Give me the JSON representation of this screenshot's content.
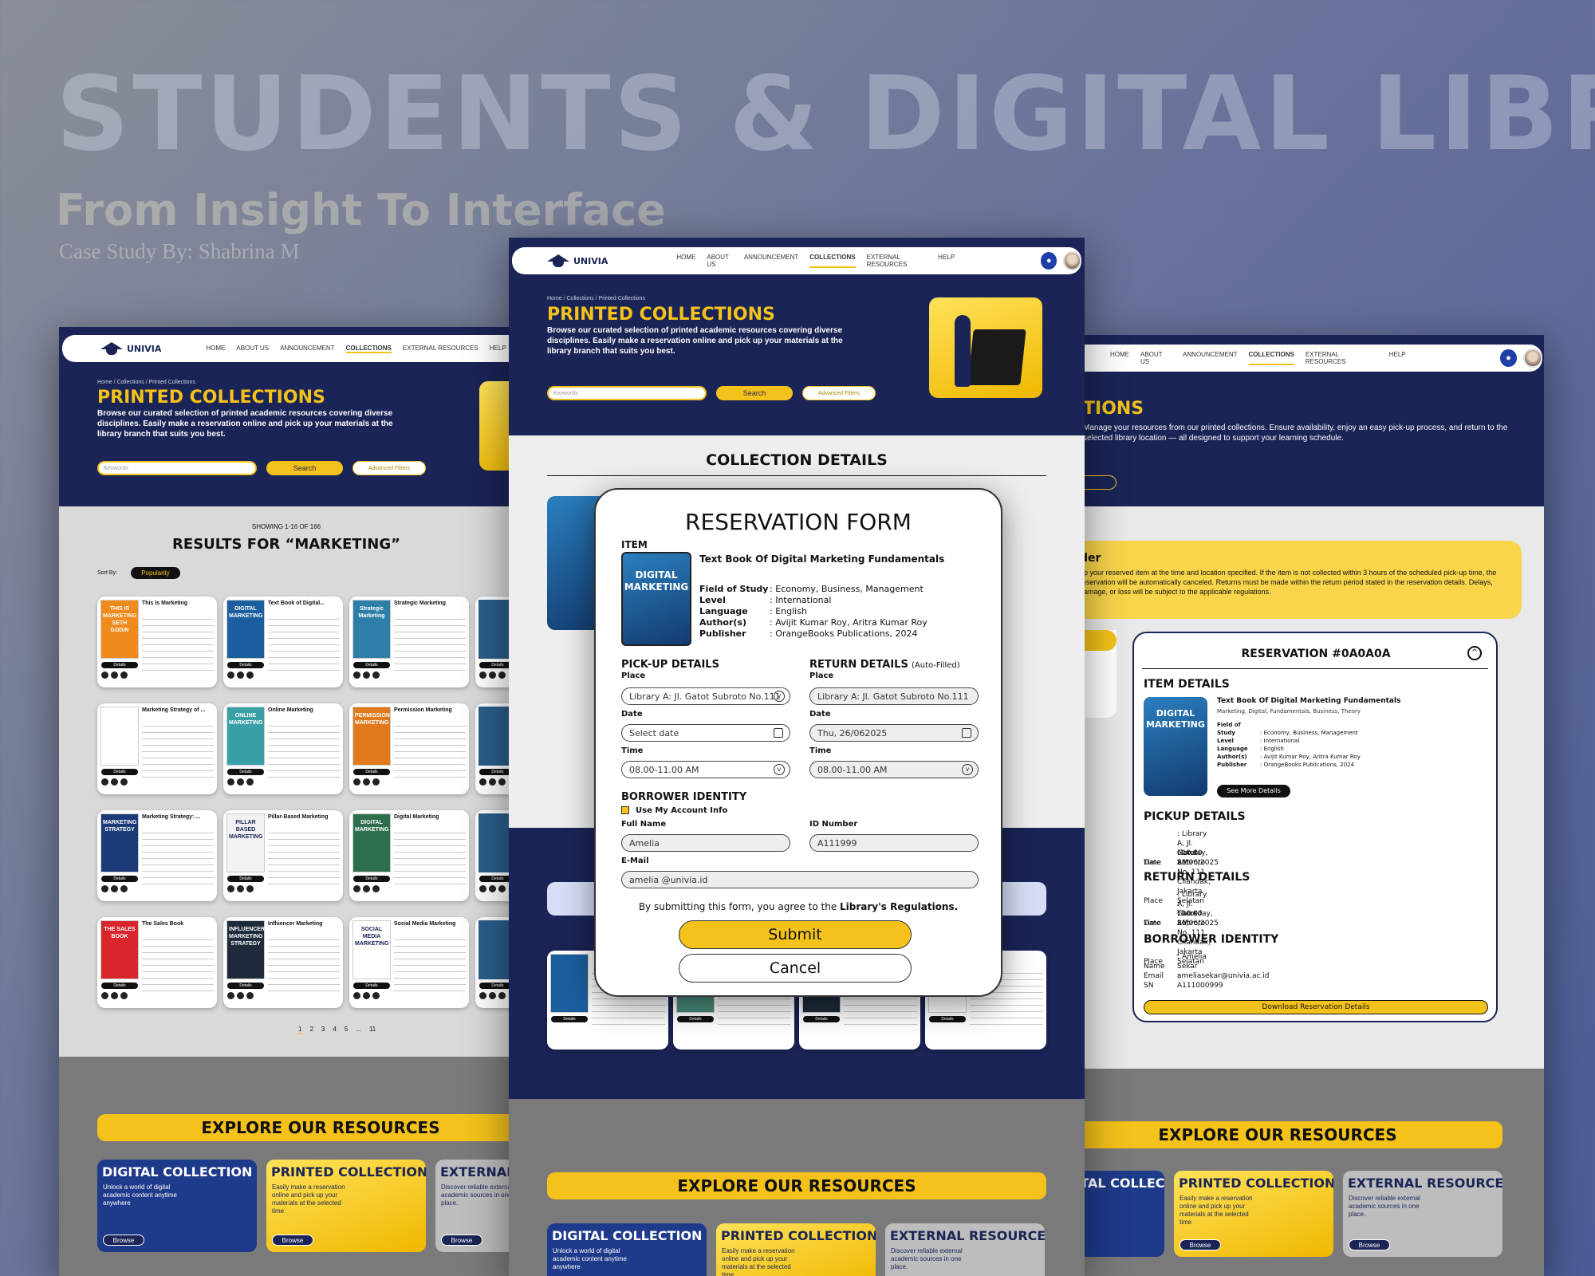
{
  "hero": {
    "title": "STUDENTS & DIGITAL LIBRARIES",
    "subtitle": "From Insight To Interface",
    "credit": "Case Study By: Shabrina M"
  },
  "nav": {
    "logo": "UNIVIA",
    "items": [
      "HOME",
      "ABOUT US",
      "ANNOUNCEMENT",
      "COLLECTIONS",
      "EXTERNAL RESOURCES",
      "HELP"
    ],
    "active": "COLLECTIONS"
  },
  "collections_page": {
    "breadcrumb": "Home / Collections / Printed Collections",
    "title": "PRINTED COLLECTIONS",
    "description": "Browse our curated selection of printed academic resources covering diverse disciplines. Easily make a reservation online and pick up your materials at the library branch that suits you best.",
    "search_placeholder": "Keywords",
    "search_button": "Search",
    "advanced_filters": "Advanced Filters"
  },
  "results": {
    "showing": "SHOWING 1-16 OF 166",
    "heading": "RESULTS FOR “MARKETING”",
    "sort_label": "Sort By:",
    "sort_value": "Popularity",
    "details_label": "Details",
    "books": [
      {
        "title": "This Is Marketing",
        "cover_text": "THIS IS MARKETING SETH GODIN",
        "cover_color": "#f08a1c"
      },
      {
        "title": "Text Book of Digital...",
        "cover_text": "DIGITAL MARKETING",
        "cover_color": "#1b5e9e"
      },
      {
        "title": "Strategic Marketing",
        "cover_text": "Strategic Marketing",
        "cover_color": "#2e7fa8"
      },
      {
        "title": "Marketing Strategy of ...",
        "cover_text": "",
        "cover_color": "#ffffff"
      },
      {
        "title": "Online Marketing",
        "cover_text": "ONLINE MARKETING",
        "cover_color": "#3aa0a8"
      },
      {
        "title": "Permission Marketing",
        "cover_text": "PERMISSION MARKETING",
        "cover_color": "#e07a1c"
      },
      {
        "title": "Marketing Strategy: ...",
        "cover_text": "MARKETING STRATEGY",
        "cover_color": "#1b3a78"
      },
      {
        "title": "Pillar-Based Marketing",
        "cover_text": "PILLAR BASED MARKETING",
        "cover_color": "#f2f2f2"
      },
      {
        "title": "Digital Marketing",
        "cover_text": "DIGITAL MARKETING",
        "cover_color": "#2c6e4e"
      },
      {
        "title": "The Sales Book",
        "cover_text": "THE SALES BOOK",
        "cover_color": "#d8262c"
      },
      {
        "title": "Influencer Marketing",
        "cover_text": "INFLUENCER MARKETING STRATEGY",
        "cover_color": "#1d2b3a"
      },
      {
        "title": "Social Media Marketing",
        "cover_text": "SOCIAL MEDIA MARKETING",
        "cover_color": "#ffffff"
      }
    ],
    "pages": [
      "1",
      "2",
      "3",
      "4",
      "5",
      "...",
      "11"
    ]
  },
  "detail_page": {
    "section_title": "COLLECTION DETAILS"
  },
  "reservation_form": {
    "title": "RESERVATION FORM",
    "item_label": "ITEM",
    "item_title": "Text Book Of Digital Marketing Fundamentals",
    "cover_text": "DIGITAL MARKETING",
    "details": [
      {
        "key": "Field of Study",
        "value": ": Economy, Business, Management"
      },
      {
        "key": "Level",
        "value": ": International"
      },
      {
        "key": "Language",
        "value": ": English"
      },
      {
        "key": "Author(s)",
        "value": ": Avijit Kumar Roy, Aritra Kumar Roy"
      },
      {
        "key": "Publisher",
        "value": ": OrangeBooks Publications, 2024"
      }
    ],
    "pickup_title": "PICK-UP DETAILS",
    "return_title": "RETURN DETAILS",
    "return_note": "(Auto-Filled)",
    "place_label": "Place",
    "date_label": "Date",
    "time_label": "Time",
    "pickup_place": "Library A: Jl. Gatot Subroto No.111",
    "pickup_date_placeholder": "Select date",
    "pickup_time": "08.00-11.00 AM",
    "return_place": "Library A: Jl. Gatot Subroto No.111",
    "return_date": "Thu, 26/062025",
    "return_time": "08.00-11.00 AM",
    "borrower_title": "BORROWER IDENTITY",
    "use_account": "Use My Account Info",
    "fullname_label": "Full Name",
    "fullname": "Amelia",
    "id_label": "ID Number",
    "id_value": "A111999",
    "email_label": "E-Mail",
    "email": "amelia @univia.id",
    "agreement_prefix": "By submitting this form, you agree to the ",
    "agreement_link": "Library's Regulations.",
    "submit": "Submit",
    "cancel": "Cancel"
  },
  "reservation_page": {
    "title_fragment": "TIONS",
    "description": "Manage your resources from our printed collections. Ensure availability, enjoy an easy pick-up process, and return to the selected library location — all designed to support your learning schedule.",
    "reminder_title": "der",
    "reminder_text": "up your reserved item at the time and location specified. If the item is not collected within 3 hours of the scheduled pick-up time, the reservation will be automatically canceled. Returns must be made within the return period stated in the reservation details. Delays, damage, or loss will be subject to the applicable regulations.",
    "reservation_id": "RESERVATION #0A0A0A",
    "item_details_title": "ITEM DETAILS",
    "item_title": "Text Book Of Digital Marketing Fundamentals",
    "item_tags": "Marketing, Digital, Fundamentals, Business, Theory",
    "item_details": [
      {
        "key": "Field of Study",
        "value": ": Economy, Business, Management"
      },
      {
        "key": "Level",
        "value": ": International"
      },
      {
        "key": "Language",
        "value": ": English"
      },
      {
        "key": "Author(s)",
        "value": ": Avijit Kumar Roy, Aritra Kumar Roy"
      },
      {
        "key": "Publisher",
        "value": ": OrangeBooks Publications, 2024"
      }
    ],
    "see_more": "See More Details",
    "pickup_title": "PICKUP  DETAILS",
    "pickup": [
      {
        "key": "Place",
        "value": ": Library A, Jl. Gatot Subroto No. 111, Cilandak, Jakarta Selatan"
      },
      {
        "key": "Date",
        "value": ": Monday, 23/06/2025"
      },
      {
        "key": "Time",
        "value": ": 10.00 AM"
      }
    ],
    "return_title": "RETURN  DETAILS",
    "return": [
      {
        "key": "Place",
        "value": ": Library A, Jl. Gatot Subroto No. 111, Cilandak, Jakarta Selatan"
      },
      {
        "key": "Date",
        "value": ": Thursday, 26/06/2025"
      },
      {
        "key": "Time",
        "value": ": 10.00 AM"
      }
    ],
    "borrower_title": "BORROWER IDENTITY",
    "borrower": [
      {
        "key": "Name",
        "value": ": Amelia Sekar"
      },
      {
        "key": "Email",
        "value": ": ameliasekar@univia.ac.id"
      },
      {
        "key": "SN",
        "value": ": A111000999"
      }
    ],
    "download": "Download Reservation Details"
  },
  "explore": {
    "title": "EXPLORE OUR RESOURCES",
    "cards": [
      {
        "title": "DIGITAL COLLECTION",
        "desc": "Unlock a world of digital academic content anytime anywhere",
        "button": "Browse"
      },
      {
        "title": "PRINTED COLLECTION",
        "desc": "Easily make a reservation online and pick up your materials at the selected time",
        "button": "Browse"
      },
      {
        "title": "EXTERNAL  RESOURCE",
        "desc": "Discover reliable external academic sources in one place.",
        "button": "Browse"
      }
    ]
  },
  "colors": {
    "navy": "#1a2456",
    "yellow": "#f4c21a",
    "grey": "#d9d9d9"
  }
}
